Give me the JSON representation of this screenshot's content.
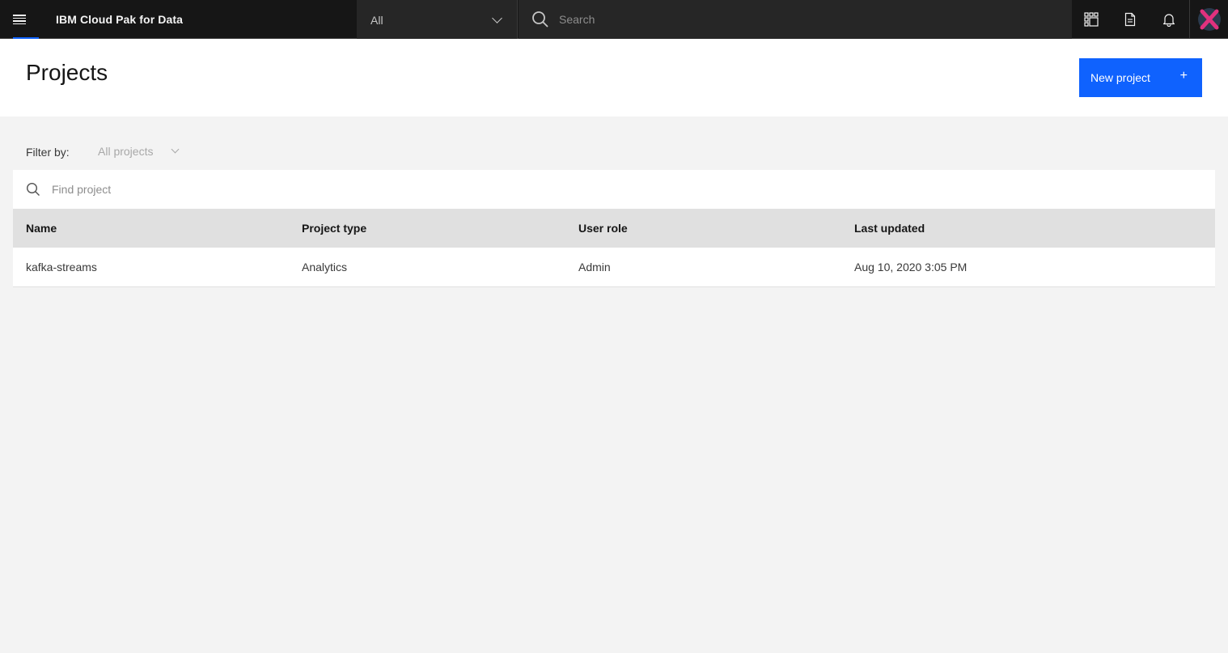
{
  "header": {
    "brand": "IBM Cloud Pak for Data",
    "scope_value": "All",
    "search_placeholder": "Search",
    "icons": [
      "menu-icon",
      "apps-icon",
      "document-icon",
      "notification-icon",
      "avatar"
    ],
    "accent": "#0f62fe"
  },
  "page": {
    "title": "Projects",
    "new_button_label": "New project",
    "new_button_icon": "+"
  },
  "filter": {
    "label": "Filter by:",
    "value": "All projects"
  },
  "table": {
    "search_placeholder": "Find project",
    "columns": [
      "Name",
      "Project type",
      "User role",
      "Last updated"
    ],
    "rows": [
      {
        "name": "kafka-streams",
        "type": "Analytics",
        "role": "Admin",
        "updated": "Aug 10, 2020 3:05 PM"
      }
    ]
  }
}
